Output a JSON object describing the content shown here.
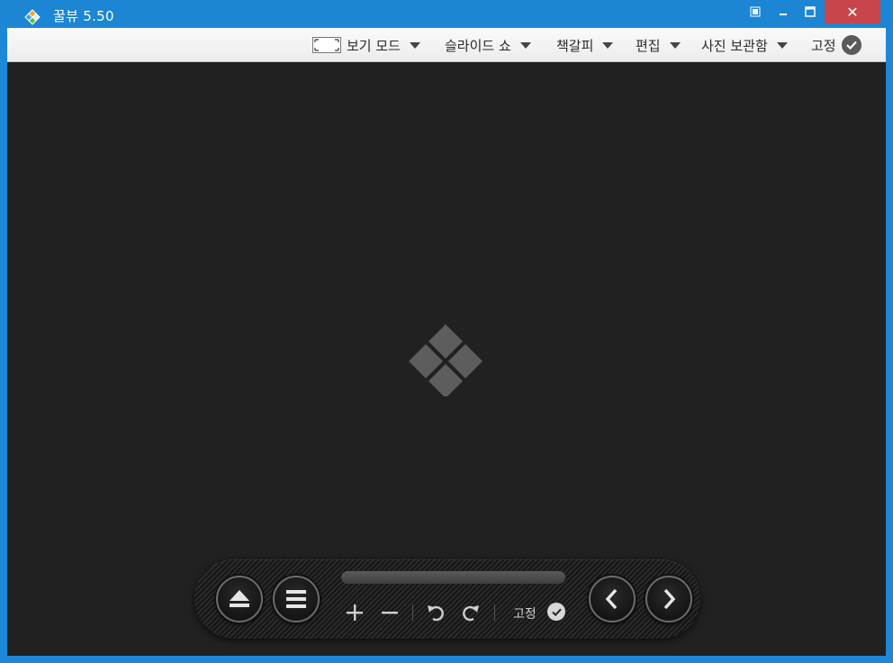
{
  "window": {
    "title": "꿀뷰 5.50",
    "close_symbol": "✕"
  },
  "menu": {
    "items": [
      {
        "label": "보기 모드",
        "icon": "fullscreen-icon"
      },
      {
        "label": "슬라이드 쇼"
      },
      {
        "label": "책갈피"
      },
      {
        "label": "편집"
      },
      {
        "label": "사진 보관함"
      }
    ],
    "pin_label": "고정"
  },
  "controls": {
    "pin_label": "고정"
  },
  "colors": {
    "titlebar": "#1c86d4",
    "close": "#c8464b",
    "viewer_bg": "#212121"
  }
}
